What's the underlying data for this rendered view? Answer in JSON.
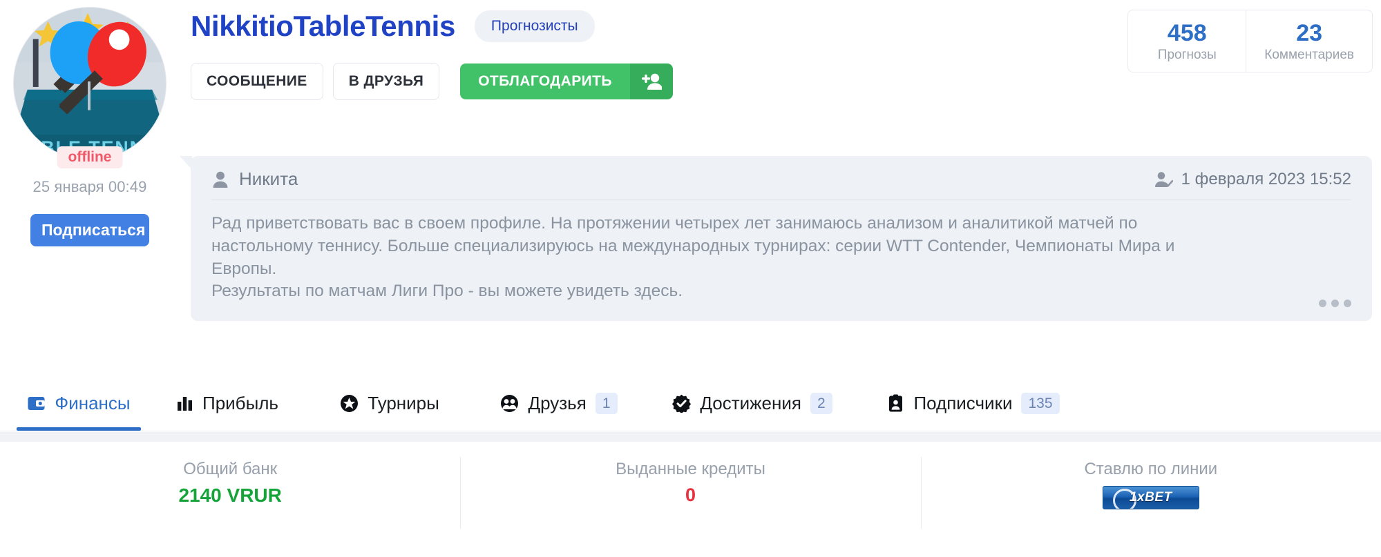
{
  "profile": {
    "username": "NikkitioTableTennis",
    "role_chip": "Прогнозисты",
    "status": "offline",
    "last_seen": "25 января 00:49",
    "subscribe_label": "Подписаться",
    "avatar_icon": "table-tennis-paddles-avatar"
  },
  "actions": {
    "message": "СООБЩЕНИЕ",
    "add_friend": "В ДРУЗЬЯ",
    "thanks": "ОТБЛАГОДАРИТЬ",
    "thanks_icon": "person-add-icon"
  },
  "stats": [
    {
      "value": "458",
      "label": "Прогнозы"
    },
    {
      "value": "23",
      "label": "Комментариев"
    }
  ],
  "message_card": {
    "author": "Никита",
    "author_icon": "person-icon",
    "date": "1 февраля 2023 15:52",
    "date_icon": "person-check-icon",
    "line1": "Рад приветствовать вас в своем профиле. На протяжении четырех лет занимаюсь анализом и аналитикой матчей по",
    "line2": "настольному теннису. Больше специализируюсь на международных турнирах: серии WTT Contender, Чемпионаты Мира и",
    "line3": "Европы.",
    "line4": "Результаты по матчам Лиги Про - вы можете увидеть здесь.",
    "more_icon": "ellipsis-icon"
  },
  "tabs": [
    {
      "label": "Финансы",
      "icon": "wallet-icon",
      "badge": "",
      "active": true
    },
    {
      "label": "Прибыль",
      "icon": "bar-chart-icon",
      "badge": "",
      "active": false
    },
    {
      "label": "Турниры",
      "icon": "star-icon",
      "badge": "",
      "active": false
    },
    {
      "label": "Друзья",
      "icon": "friends-icon",
      "badge": "1",
      "active": false
    },
    {
      "label": "Достижения",
      "icon": "badge-check-icon",
      "badge": "2",
      "active": false
    },
    {
      "label": "Подписчики",
      "icon": "contact-card-icon",
      "badge": "135",
      "active": false
    }
  ],
  "finance": [
    {
      "label": "Общий банк",
      "value": "2140 VRUR",
      "color": "green"
    },
    {
      "label": "Выданные кредиты",
      "value": "0",
      "color": "red"
    },
    {
      "label": "Ставлю по линии",
      "value": "",
      "logo": "1xBET"
    }
  ],
  "colors": {
    "brand_blue": "#1f43c4",
    "link_blue": "#2d6fc7",
    "green": "#41c268",
    "money_green": "#16a43a",
    "red": "#e8303f",
    "offline_pink": "#f0596a"
  }
}
